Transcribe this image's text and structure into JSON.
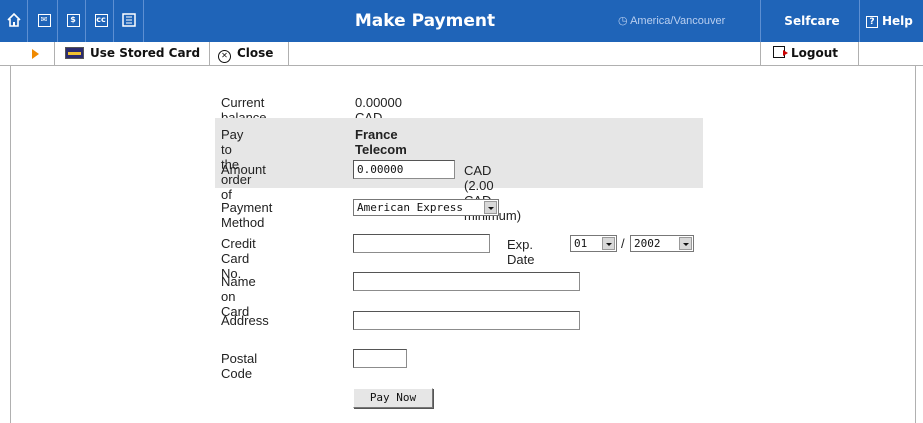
{
  "header": {
    "title": "Make Payment",
    "timezone": "America/Vancouver",
    "selfcare_label": "Selfcare",
    "help_label": "Help",
    "icons": [
      "home-icon",
      "mail-icon",
      "dollar-icon",
      "cc-icon",
      "list-icon"
    ]
  },
  "toolbar": {
    "use_stored_card_label": "Use Stored Card",
    "close_label": "Close",
    "logout_label": "Logout"
  },
  "form": {
    "current_balance_label": "Current balance",
    "current_balance_value": "0.00000 CAD",
    "pay_to_label": "Pay to the order of",
    "pay_to_value": "France Telecom",
    "amount_label": "Amount",
    "amount_value": "0.00000",
    "amount_note": "CAD  (2.00 CAD minimum)",
    "payment_method_label": "Payment Method",
    "payment_method_value": "American Express",
    "card_no_label": "Credit Card No.",
    "card_no_value": "",
    "exp_date_label": "Exp. Date",
    "exp_month_value": "01",
    "exp_separator": "/",
    "exp_year_value": "2002",
    "name_label": "Name on Card",
    "name_value": "",
    "address_label": "Address",
    "address_value": "",
    "postal_label": "Postal Code",
    "postal_value": "",
    "pay_button_label": "Pay Now"
  },
  "colors": {
    "header_bg": "#1f64b8",
    "accent_arrow": "#f08a00",
    "gray_row": "#e6e6e6"
  }
}
